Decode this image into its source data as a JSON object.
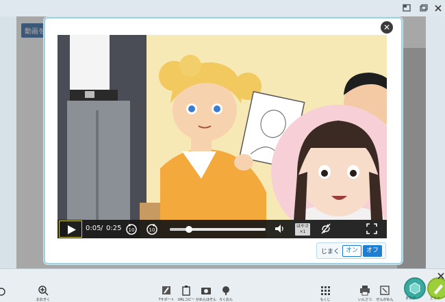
{
  "page": {
    "tag": "動画を"
  },
  "modal": {
    "close_label": "✕"
  },
  "video": {
    "current_time": "0:05",
    "separator": "/",
    "duration": "0:25",
    "progress": 0.2,
    "speed_label_top": "はやさ",
    "speed_label_bottom": "×1"
  },
  "subtitles": {
    "label": "じまく",
    "on_label": "オン",
    "off_label": "オフ",
    "selected": "off"
  },
  "toolbar": {
    "items": [
      {
        "label": "おおきく"
      },
      {
        "label": "Tサポート"
      },
      {
        "label": "URLコピー"
      },
      {
        "label": "がめんほぞん"
      },
      {
        "label": "ろくおん"
      },
      {
        "label": "もくじ"
      },
      {
        "label": "いんさつ"
      },
      {
        "label": "ぜんがめん"
      },
      {
        "label": "まなび"
      },
      {
        "label": "どうぐ"
      }
    ]
  },
  "colors": {
    "accent": "#1e7ed1",
    "modal_border": "#9fd0e3",
    "play_focus": "#d5cc3a"
  }
}
